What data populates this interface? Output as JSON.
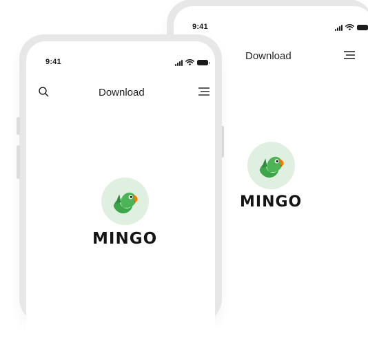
{
  "back_phone": {
    "status": {
      "time": "9:41"
    },
    "header": {
      "title": "Download",
      "menu_icon": "hamburger-menu-icon"
    },
    "logo": {
      "name": "MINGO",
      "icon": "parrot-logo-icon"
    }
  },
  "front_phone": {
    "status": {
      "time": "9:41"
    },
    "header": {
      "title": "Download",
      "search_icon": "search-icon",
      "menu_icon": "hamburger-menu-icon"
    },
    "logo": {
      "name": "MINGO",
      "icon": "parrot-logo-icon"
    }
  },
  "colors": {
    "frame": "#e7e7e7",
    "logo_bg": "#dff0e1",
    "parrot_green": "#4caf50",
    "parrot_dark_green": "#2e8b3e",
    "beak_orange": "#f57c00",
    "text": "#1c1c1c"
  }
}
